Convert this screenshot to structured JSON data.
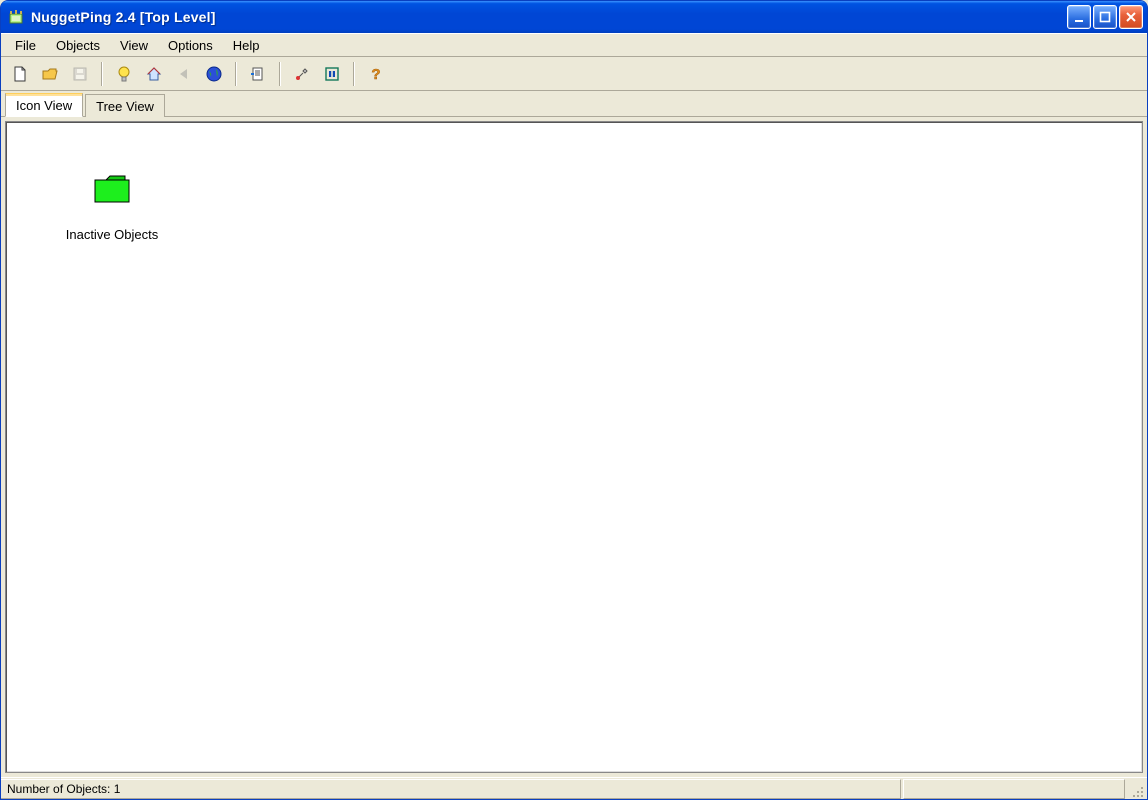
{
  "window": {
    "title": "NuggetPing 2.4 [Top Level]"
  },
  "menu": {
    "items": [
      "File",
      "Objects",
      "View",
      "Options",
      "Help"
    ]
  },
  "toolbar": {
    "buttons": [
      {
        "name": "new",
        "label": "New"
      },
      {
        "name": "open",
        "label": "Open"
      },
      {
        "name": "save",
        "label": "Save",
        "disabled": true
      },
      {
        "name": "sep"
      },
      {
        "name": "lightbulb",
        "label": "Hint"
      },
      {
        "name": "home",
        "label": "Home"
      },
      {
        "name": "back",
        "label": "Back",
        "disabled": true
      },
      {
        "name": "globe",
        "label": "Internet"
      },
      {
        "name": "sep"
      },
      {
        "name": "report",
        "label": "Report"
      },
      {
        "name": "sep"
      },
      {
        "name": "tools",
        "label": "Tools"
      },
      {
        "name": "pause",
        "label": "Pause"
      },
      {
        "name": "sep"
      },
      {
        "name": "help",
        "label": "Help"
      }
    ]
  },
  "tabs": {
    "items": [
      "Icon View",
      "Tree View"
    ],
    "active": 0
  },
  "content": {
    "folder_label": "Inactive Objects"
  },
  "status": {
    "text": "Number of Objects:  1"
  },
  "colors": {
    "folder_fill": "#1def1d",
    "folder_stroke": "#000000"
  }
}
